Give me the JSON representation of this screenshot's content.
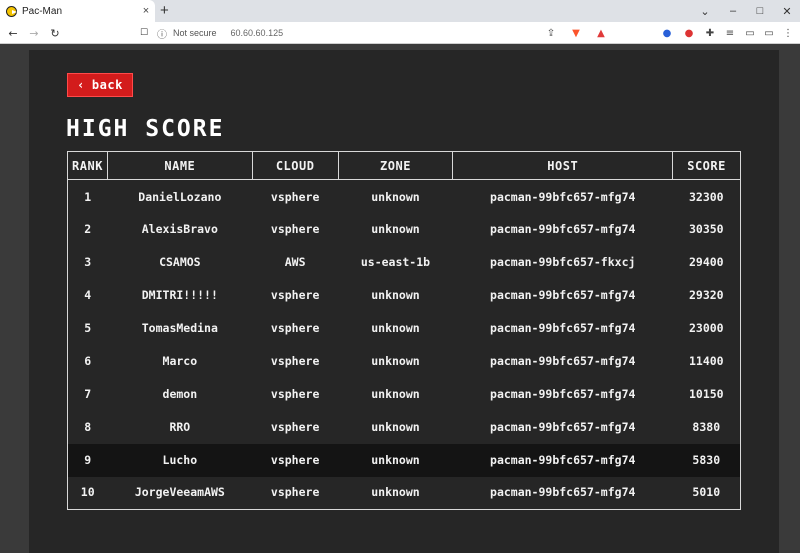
{
  "browser": {
    "tab_title": "Pac-Man",
    "tab_close": "×",
    "new_tab": "+",
    "window_controls": {
      "collapse": "⌄",
      "minimize": "–",
      "maximize": "□",
      "close": "✕"
    },
    "nav": {
      "back": "←",
      "forward": "→",
      "reload": "↻",
      "bookmark": "☐"
    },
    "address": {
      "security_status": "Not secure",
      "url": "60.60.60.125"
    }
  },
  "page": {
    "back_label": "back",
    "back_icon": "‹",
    "title": "HIGH SCORE"
  },
  "table": {
    "headers": {
      "rank": "RANK",
      "name": "NAME",
      "cloud": "CLOUD",
      "zone": "ZONE",
      "host": "HOST",
      "score": "SCORE"
    },
    "rows": [
      {
        "rank": "1",
        "name": "DanielLozano",
        "cloud": "vsphere",
        "zone": "unknown",
        "host": "pacman-99bfc657-mfg74",
        "score": "32300"
      },
      {
        "rank": "2",
        "name": "AlexisBravo",
        "cloud": "vsphere",
        "zone": "unknown",
        "host": "pacman-99bfc657-mfg74",
        "score": "30350"
      },
      {
        "rank": "3",
        "name": "CSAMOS",
        "cloud": "AWS",
        "zone": "us-east-1b",
        "host": "pacman-99bfc657-fkxcj",
        "score": "29400"
      },
      {
        "rank": "4",
        "name": "DMITRI!!!!!",
        "cloud": "vsphere",
        "zone": "unknown",
        "host": "pacman-99bfc657-mfg74",
        "score": "29320"
      },
      {
        "rank": "5",
        "name": "TomasMedina",
        "cloud": "vsphere",
        "zone": "unknown",
        "host": "pacman-99bfc657-mfg74",
        "score": "23000"
      },
      {
        "rank": "6",
        "name": "Marco",
        "cloud": "vsphere",
        "zone": "unknown",
        "host": "pacman-99bfc657-mfg74",
        "score": "11400"
      },
      {
        "rank": "7",
        "name": "demon",
        "cloud": "vsphere",
        "zone": "unknown",
        "host": "pacman-99bfc657-mfg74",
        "score": "10150"
      },
      {
        "rank": "8",
        "name": "RRO",
        "cloud": "vsphere",
        "zone": "unknown",
        "host": "pacman-99bfc657-mfg74",
        "score": "8380"
      },
      {
        "rank": "9",
        "name": "Lucho",
        "cloud": "vsphere",
        "zone": "unknown",
        "host": "pacman-99bfc657-mfg74",
        "score": "5830"
      },
      {
        "rank": "10",
        "name": "JorgeVeeamAWS",
        "cloud": "vsphere",
        "zone": "unknown",
        "host": "pacman-99bfc657-mfg74",
        "score": "5010"
      }
    ]
  },
  "colors": {
    "accent": "#d31c1c",
    "background": "#3a3a3a",
    "panel": "#262626",
    "text": "#f2f2f2"
  }
}
